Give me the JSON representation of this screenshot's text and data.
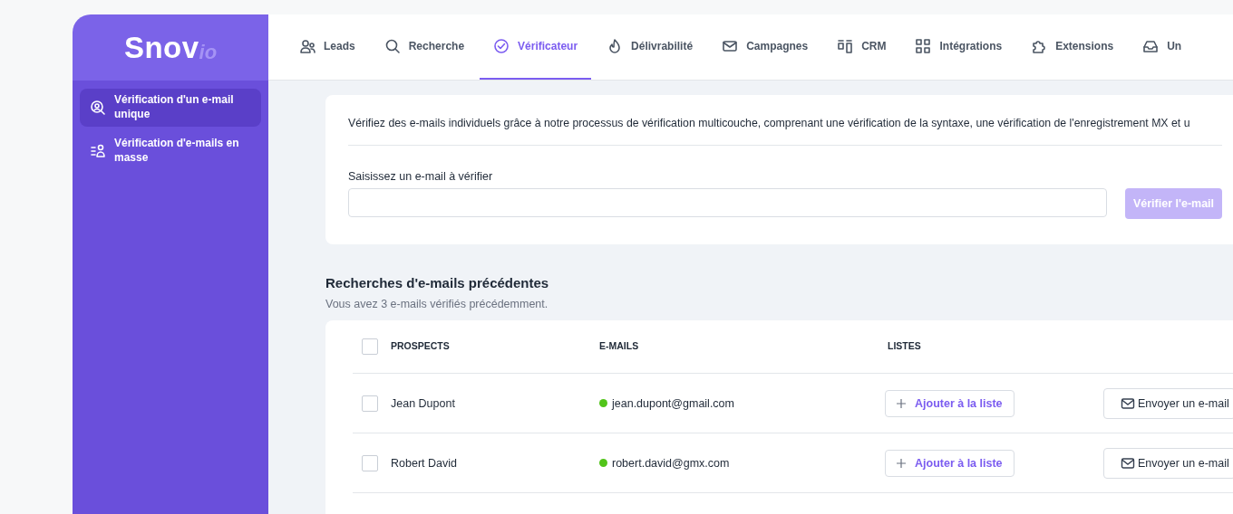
{
  "logo": {
    "main": "Snov",
    "suffix": "io"
  },
  "sidebar": {
    "items": [
      {
        "label": "Vérification d'un e-mail unique",
        "selected": true
      },
      {
        "label": "Vérification d'e-mails en masse",
        "selected": false
      }
    ]
  },
  "nav": {
    "tabs": [
      {
        "label": "Leads",
        "selected": false
      },
      {
        "label": "Recherche",
        "selected": false
      },
      {
        "label": "Vérificateur",
        "selected": true
      },
      {
        "label": "Délivrabilité",
        "selected": false
      },
      {
        "label": "Campagnes",
        "selected": false
      },
      {
        "label": "CRM",
        "selected": false
      },
      {
        "label": "Intégrations",
        "selected": false
      },
      {
        "label": "Extensions",
        "selected": false
      },
      {
        "label": "Un",
        "selected": false
      }
    ]
  },
  "verify_card": {
    "description": "Vérifiez des e-mails individuels grâce à notre processus de vérification multicouche, comprenant une vérification de la syntaxe, une vérification de l'enregistrement MX et u",
    "field_label": "Saisissez un e-mail à vérifier",
    "button": {
      "label": "Vérifier l'e-mail",
      "disabled": true
    }
  },
  "history": {
    "title": "Recherches d'e-mails précédentes",
    "subtitle": "Vous avez 3 e-mails vérifiés précédemment.",
    "table": {
      "select_all_checked": false,
      "columns": [
        "PROSPECTS",
        "E-MAILS",
        "LISTES"
      ],
      "rows": [
        {
          "checked": false,
          "name": "Jean Dupont",
          "email": "jean.dupont@gmail.com",
          "add_button": "Ajouter à la liste",
          "send_button": "Envoyer un e-mail"
        },
        {
          "checked": false,
          "name": "Robert David",
          "email": "robert.david@gmx.com",
          "add_button": "Ajouter à la liste",
          "send_button": "Envoyer un e-mail"
        }
      ]
    }
  }
}
